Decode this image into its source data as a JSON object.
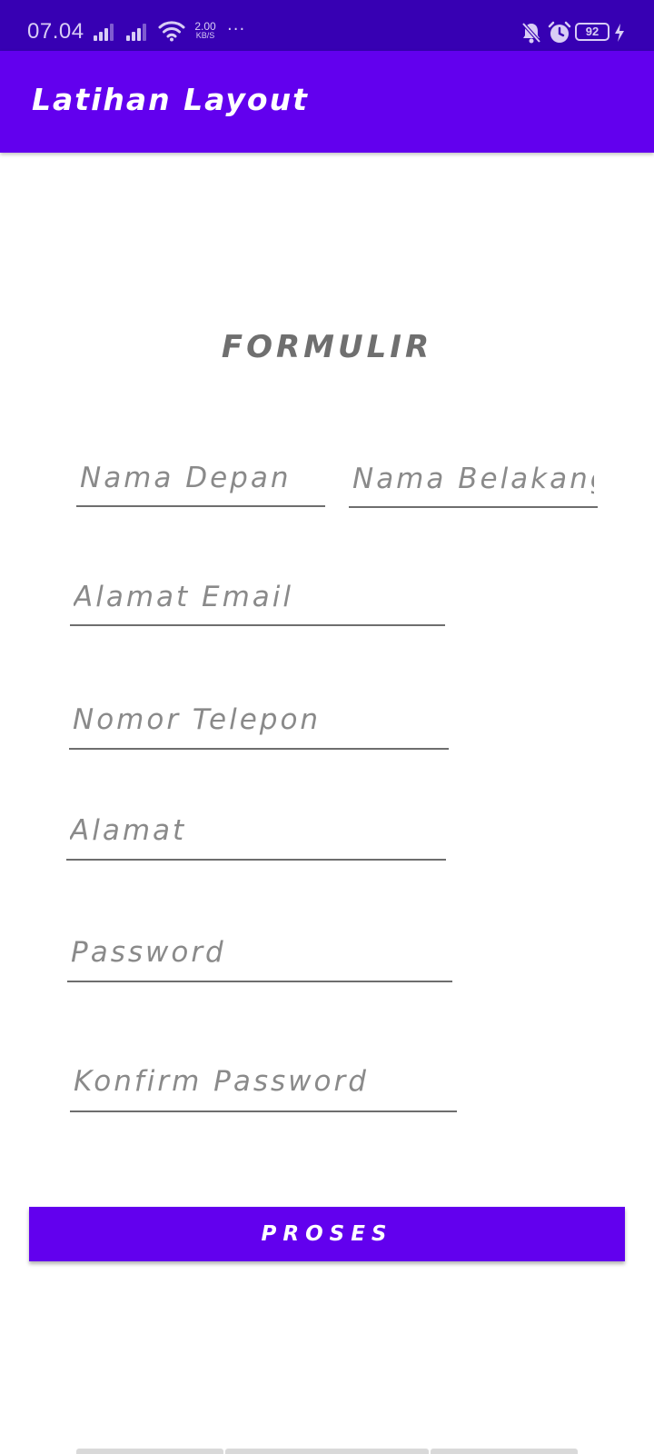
{
  "status_bar": {
    "time": "07.04",
    "net_speed_value": "2.00",
    "net_speed_unit": "KB/S",
    "more": "···",
    "battery": "92",
    "icons": [
      "signal-icon",
      "signal-icon",
      "wifi-icon",
      "bell-off-icon",
      "alarm-icon",
      "battery-icon",
      "charging-icon"
    ]
  },
  "app_bar": {
    "title": "Latihan Layout"
  },
  "form": {
    "title": "FORMULIR",
    "first_name_placeholder": "Nama Depan",
    "last_name_placeholder": "Nama Belakang",
    "email_placeholder": "Alamat Email",
    "phone_placeholder": "Nomor Telepon",
    "address_placeholder": "Alamat",
    "password_placeholder": "Password",
    "confirm_password_placeholder": "Konfirm Password",
    "submit_label": "PROSES"
  },
  "colors": {
    "status_bar": "#3700b3",
    "primary": "#6200ee",
    "hint_text": "#8a8a8a",
    "underline": "#6e6e6e"
  }
}
